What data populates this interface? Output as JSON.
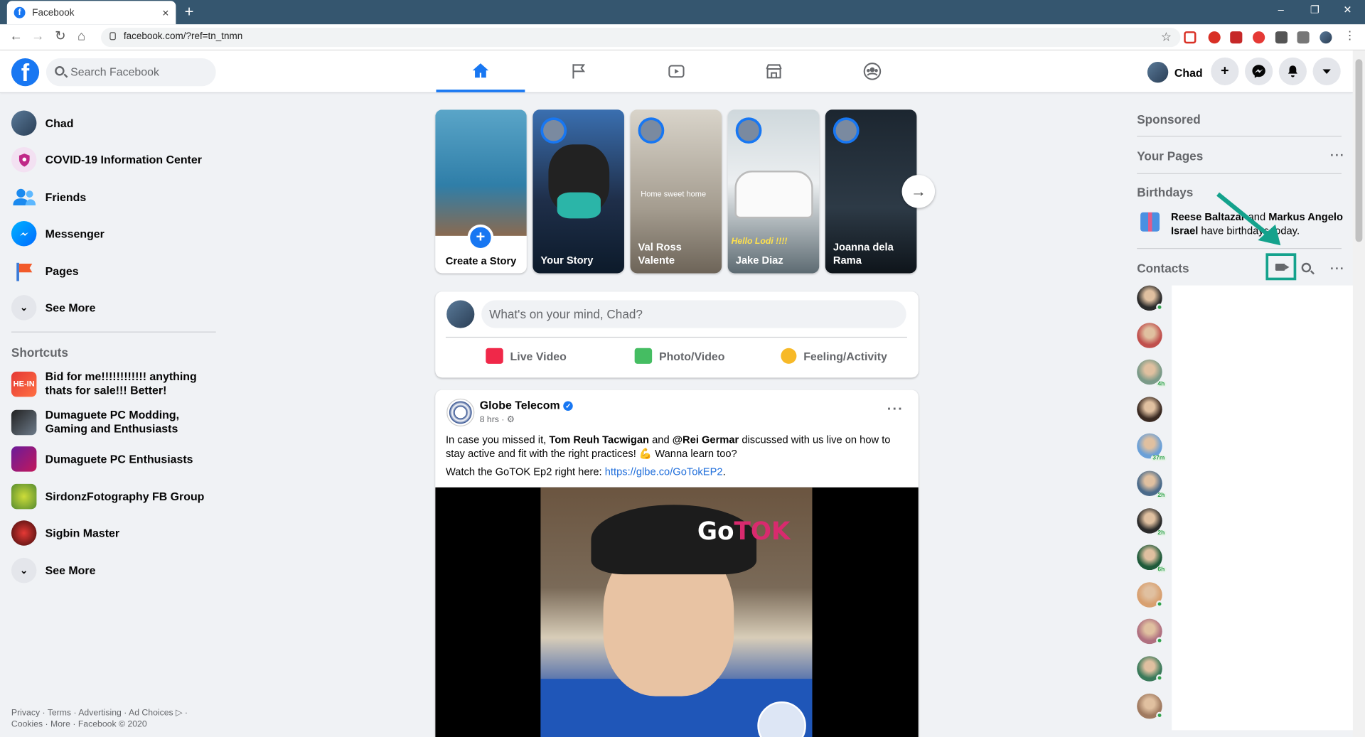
{
  "browser": {
    "tab_title": "Facebook",
    "tab_close": "×",
    "new_tab": "+",
    "url": "facebook.com/?ref=tn_tnmn",
    "window_controls": [
      "–",
      "❐",
      "✕"
    ]
  },
  "header": {
    "logo": "f",
    "search_placeholder": "Search Facebook",
    "nav_tabs": [
      "home",
      "pages",
      "watch",
      "marketplace",
      "groups"
    ],
    "active_tab": "home",
    "profile_name": "Chad",
    "create_label": "+"
  },
  "left_nav": {
    "items": [
      {
        "label": "Chad",
        "icon": "avatar"
      },
      {
        "label": "COVID-19 Information Center",
        "icon": "covid-shield-icon"
      },
      {
        "label": "Friends",
        "icon": "friends-icon"
      },
      {
        "label": "Messenger",
        "icon": "messenger-icon"
      },
      {
        "label": "Pages",
        "icon": "pages-flag-icon"
      },
      {
        "label": "See More",
        "icon": "chevron-down-icon"
      }
    ],
    "shortcuts_title": "Shortcuts",
    "shortcuts": [
      {
        "label": "Bid for me!!!!!!!!!!!! anything thats for sale!!! Better!"
      },
      {
        "label": "Dumaguete PC Modding, Gaming and Enthusiasts"
      },
      {
        "label": "Dumaguete PC Enthusiasts"
      },
      {
        "label": "SirdonzFotography FB Group"
      },
      {
        "label": "Sigbin Master"
      },
      {
        "label": "See More"
      }
    ],
    "footer": "Privacy · Terms · Advertising · Ad Choices ▷ · Cookies · More · Facebook © 2020"
  },
  "stories": [
    {
      "name": "Create a Story"
    },
    {
      "name": "Your Story"
    },
    {
      "name": "Val Ross Valente",
      "overlay": "Home sweet home"
    },
    {
      "name": "Jake Diaz",
      "overlay": "Hello Lodi !!!!"
    },
    {
      "name": "Joanna dela Rama"
    }
  ],
  "composer": {
    "placeholder": "What's on your mind, Chad?",
    "actions": [
      "Live Video",
      "Photo/Video",
      "Feeling/Activity"
    ]
  },
  "post": {
    "author": "Globe Telecom",
    "time": "8 hrs · ⚙",
    "text_1": "In case you missed it, ",
    "mention_1": "Tom Reuh Tacwigan",
    "text_2": " and ",
    "mention_2": "@Rei Germar",
    "text_3": " discussed with us live on how to stay active and fit with the right practices! 💪 Wanna learn too?",
    "watch_text": "Watch the GoTOK Ep2 right here: ",
    "link": "https://glbe.co/GoTokEP2",
    "link_suffix": ".",
    "video_brand_a": "Go",
    "video_brand_b": "TOK",
    "menu": "···"
  },
  "right_rail": {
    "sponsored": "Sponsored",
    "your_pages": "Your Pages",
    "birthdays": "Birthdays",
    "birthday_names": "Reese Baltazar",
    "birthday_mid": " and ",
    "birthday_names_2": "Markus Angelo Israel",
    "birthday_suffix": " have birthdays today.",
    "contacts": "Contacts",
    "more": "···",
    "contact_badges": [
      "online",
      "",
      "4h",
      "",
      "37m",
      "2h",
      "2h",
      "6h",
      "online",
      "online",
      "online",
      "online"
    ]
  },
  "colors": {
    "brand": "#1877f2",
    "highlight_box": "#14a28c",
    "online": "#31a24c"
  }
}
